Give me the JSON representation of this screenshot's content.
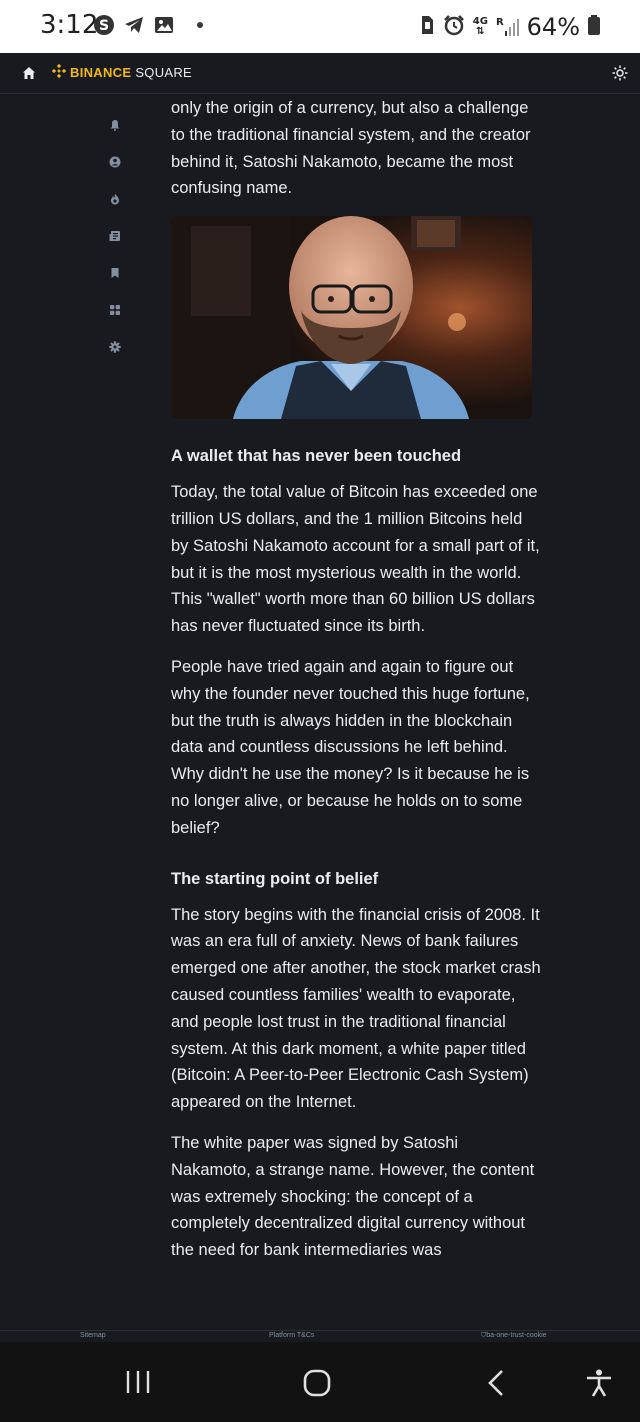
{
  "status_bar": {
    "time": "3:12",
    "network": "4G",
    "roaming": "R",
    "battery": "64%"
  },
  "top_nav": {
    "brand_binance": "BINANCE",
    "brand_square": "SQUARE"
  },
  "side_rail": [
    "bell-icon",
    "profile-icon",
    "fire-icon",
    "news-icon",
    "bookmark-icon",
    "apps-grid-icon",
    "settings-icon"
  ],
  "article": {
    "intro_paragraph": "only the origin of a currency, but also a challenge to the traditional financial system, and the creator behind it, Satoshi Nakamoto, became the most confusing name.",
    "heading_1": "A wallet that has never been touched",
    "paragraph_1": "Today, the total value of Bitcoin has exceeded one trillion US dollars, and the 1 million Bitcoins held by Satoshi Nakamoto account for a small part of it, but it is the most mysterious wealth in the world. This \"wallet\" worth more than 60 billion US dollars has never fluctuated since its birth.",
    "paragraph_2": "People have tried again and again to figure out why the founder never touched this huge fortune, but the truth is always hidden in the blockchain data and countless discussions he left behind. Why didn't he use the money? Is it because he is no longer alive, or because he holds on to some belief?",
    "heading_2": "The starting point of belief",
    "paragraph_3": "The story begins with the financial crisis of 2008. It was an era full of anxiety. News of bank failures emerged one after another, the stock market crash caused countless families' wealth to evaporate, and people lost trust in the traditional financial system. At this dark moment, a white paper titled (Bitcoin: A Peer-to-Peer Electronic Cash System) appeared on the Internet.",
    "paragraph_4": "The white paper was signed by Satoshi Nakamoto, a strange name. However, the content was extremely shocking: the concept of a completely decentralized digital currency without the need for bank intermediaries was"
  },
  "footer": {
    "sitemap": "Sitemap",
    "platform_tcs": "Platform T&Cs",
    "cookie": "ba-one-trust-cookie"
  },
  "colors": {
    "background": "#181a20",
    "brand_yellow": "#f0b90b",
    "text": "#eaecef",
    "muted": "#848e9c"
  }
}
